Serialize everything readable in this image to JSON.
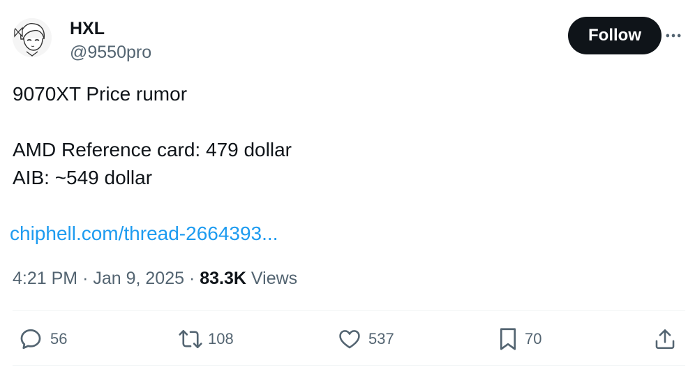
{
  "author": {
    "display_name": "HXL",
    "handle": "@9550pro"
  },
  "follow_button": {
    "label": "Follow"
  },
  "post": {
    "lines": [
      "9070XT Price rumor",
      "AMD Reference card: 479 dollar",
      "AIB: ~549 dollar"
    ],
    "link_text": "chiphell.com/thread-2664393..."
  },
  "meta": {
    "time": "4:21 PM",
    "separator": "·",
    "date": "Jan 9, 2025",
    "views_count": "83.3K",
    "views_label": "Views"
  },
  "actions": {
    "replies": "56",
    "reposts": "108",
    "likes": "537",
    "bookmarks": "70"
  },
  "colors": {
    "link": "#1d9bf0",
    "text_primary": "#0f1419",
    "text_secondary": "#536471",
    "divider": "#eff3f4"
  },
  "icons": [
    "more-icon",
    "reply-icon",
    "repost-icon",
    "like-icon",
    "bookmark-icon",
    "share-icon"
  ]
}
